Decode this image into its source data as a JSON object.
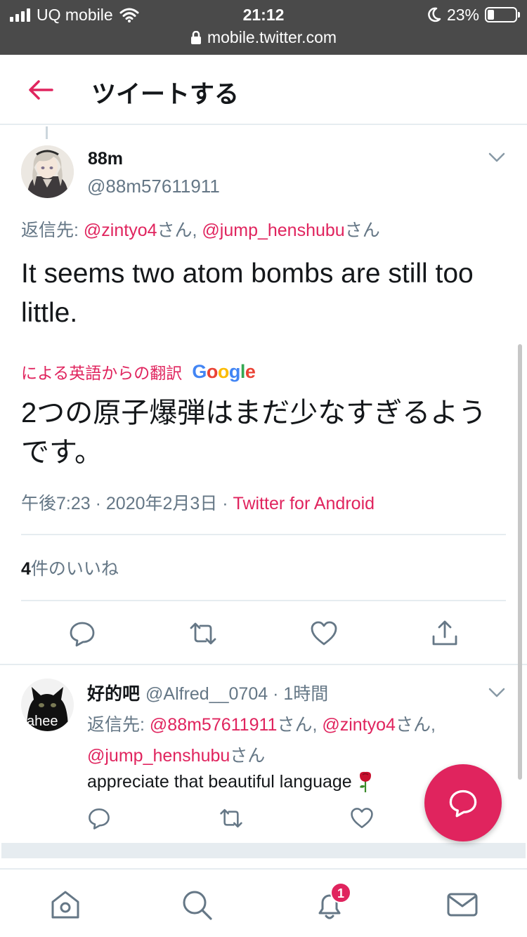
{
  "status_bar": {
    "carrier": "UQ mobile",
    "time": "21:12",
    "battery": "23%",
    "battery_level": 0.23,
    "url": "mobile.twitter.com"
  },
  "header": {
    "title": "ツイートする"
  },
  "tweet": {
    "display_name": "88m",
    "handle": "@88m57611911",
    "reply_prefix": "返信先: ",
    "reply_to": [
      {
        "handle": "@zintyo4",
        "suffix": "さん, "
      },
      {
        "handle": "@jump_henshubu",
        "suffix": "さん"
      }
    ],
    "text": "It seems two atom bombs are still too little.",
    "translation_label": "による英語からの翻訳",
    "translation_provider": "Google",
    "translated_text": "2つの原子爆弾はまだ少なすぎるようです。",
    "time": "午後7:23",
    "dot1": " · ",
    "date": "2020年2月3日",
    "dot2": " · ",
    "source": "Twitter for Android",
    "likes_count": "4",
    "likes_label1": "件の",
    "likes_label2": "いいね"
  },
  "reply": {
    "display_name": "好的吧",
    "handle": "@Alfred__0704",
    "dot": " · ",
    "time_ago": "1時間",
    "reply_prefix": "返信先: ",
    "reply_to": [
      {
        "handle": "@88m57611911",
        "suffix": "さん, "
      },
      {
        "handle": "@zintyo4",
        "suffix": "さん, "
      },
      {
        "handle": "@jump_henshubu",
        "suffix": "さん"
      }
    ],
    "text": "appreciate that beautiful language",
    "emoji": "rose",
    "avatar_text": "ahee"
  },
  "bottom_nav": {
    "notification_badge": "1",
    "items": [
      "home-icon",
      "search-icon",
      "bell-icon",
      "mail-icon"
    ]
  },
  "colors": {
    "accent": "#e0245e",
    "secondary_text": "#657786",
    "primary_text": "#14171a",
    "status_bar_bg": "#4a4a4a"
  }
}
